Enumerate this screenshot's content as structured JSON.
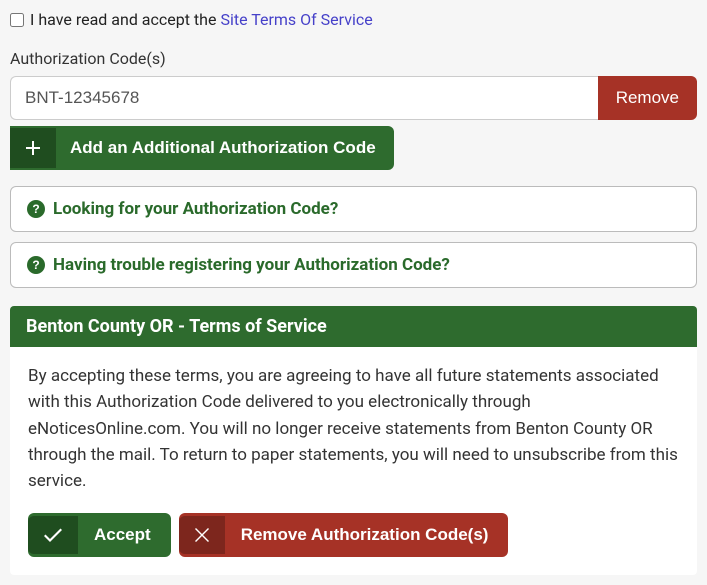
{
  "terms_checkbox": {
    "prefix": "I have read and accept the ",
    "link_text": "Site Terms Of Service",
    "checked": false
  },
  "auth_section": {
    "label": "Authorization Code(s)",
    "codes": [
      {
        "value": "BNT-12345678",
        "remove_label": "Remove"
      }
    ],
    "add_label": "Add an Additional Authorization Code"
  },
  "help": {
    "find_code": "Looking for your Authorization Code?",
    "trouble": "Having trouble registering your Authorization Code?"
  },
  "tos_panel": {
    "header": "Benton County OR - Terms of Service",
    "body": "By accepting these terms, you are agreeing to have all future statements associated with this Authorization Code delivered to you electronically through eNoticesOnline.com. You will no longer receive statements from Benton County OR through the mail. To return to paper statements, you will need to unsubscribe from this service.",
    "accept_label": "Accept",
    "remove_label": "Remove Authorization Code(s)"
  },
  "colors": {
    "green": "#2e6b2e",
    "green_dark": "#1f4d1f",
    "red": "#a63226",
    "red_dark": "#7d261d",
    "link": "#4641c9"
  }
}
